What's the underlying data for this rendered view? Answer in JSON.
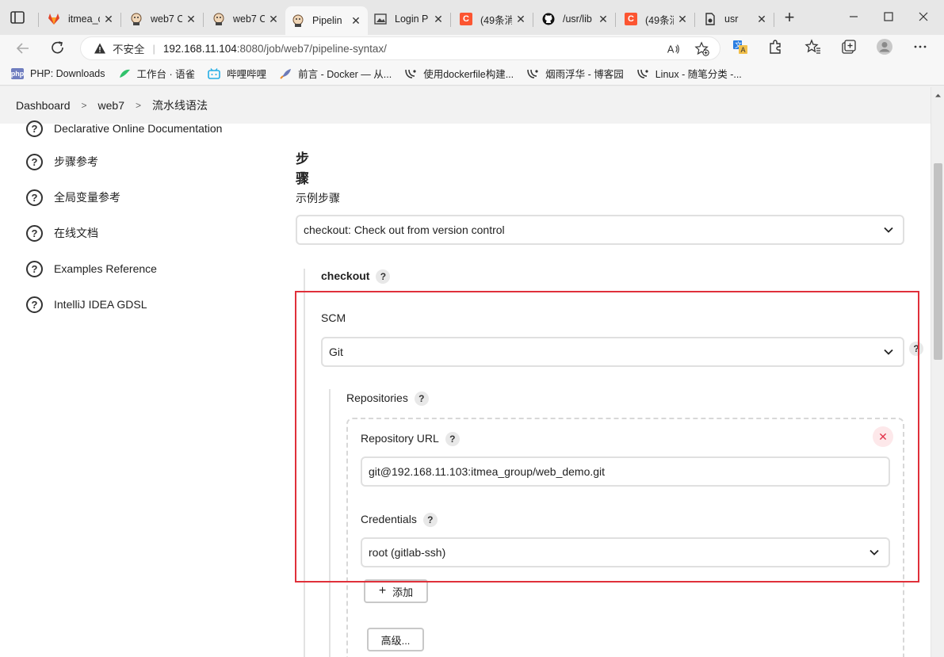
{
  "browser": {
    "tabs": [
      {
        "label": "itmea_c",
        "icon": "gitlab-icon",
        "color": "#e24329"
      },
      {
        "label": "web7 C",
        "icon": "jenkins-icon",
        "color": "#d33833"
      },
      {
        "label": "web7 C",
        "icon": "jenkins-icon",
        "color": "#d33833"
      },
      {
        "label": "Pipelin",
        "icon": "jenkins-icon",
        "color": "#d33833"
      },
      {
        "label": "Login P",
        "icon": "image-icon",
        "color": "#444444"
      },
      {
        "label": "(49条消",
        "icon": "csdn-icon",
        "color": "#fc5531"
      },
      {
        "label": "/usr/lib",
        "icon": "github-icon",
        "color": "#111111"
      },
      {
        "label": "(49条消",
        "icon": "csdn-icon",
        "color": "#fc5531"
      },
      {
        "label": "usr",
        "icon": "file-icon",
        "color": "#333333"
      }
    ],
    "address": {
      "insecure_label": "不安全",
      "url_host": "192.168.11.104",
      "url_rest": ":8080/job/web7/pipeline-syntax/"
    },
    "bookmarks": [
      {
        "label": "PHP: Downloads",
        "icon": "php-icon"
      },
      {
        "label": "工作台 · 语雀",
        "icon": "yuque-icon"
      },
      {
        "label": "哔哩哔哩",
        "icon": "bilibili-icon"
      },
      {
        "label": "前言 - Docker — 从...",
        "icon": "rocket-icon"
      },
      {
        "label": "使用dockerfile构建...",
        "icon": "cnblogs-icon"
      },
      {
        "label": "烟雨浮华 - 博客园",
        "icon": "cnblogs-icon"
      },
      {
        "label": "Linux - 随笔分类 -...",
        "icon": "cnblogs-icon"
      }
    ]
  },
  "breadcrumb": [
    "Dashboard",
    "web7",
    "流水线语法"
  ],
  "sidebar": {
    "items": [
      {
        "label": "Declarative Online Documentation"
      },
      {
        "label": "步骤参考"
      },
      {
        "label": "全局变量参考"
      },
      {
        "label": "在线文档"
      },
      {
        "label": "Examples Reference"
      },
      {
        "label": "IntelliJ IDEA GDSL"
      }
    ]
  },
  "main": {
    "heading": "步骤",
    "sample_step_label": "示例步骤",
    "sample_step_value": "checkout: Check out from version control",
    "checkout_label": "checkout",
    "scm_label": "SCM",
    "scm_value": "Git",
    "repositories_label": "Repositories",
    "repo_url_label": "Repository URL",
    "repo_url_value": "git@192.168.11.103:itmea_group/web_demo.git",
    "credentials_label": "Credentials",
    "credentials_value": "root (gitlab-ssh)",
    "add_button_label": "添加",
    "advanced_button_label": "高级...",
    "help_glyph": "?",
    "delete_glyph": "✕"
  },
  "colors": {
    "highlight_border": "#e0303a",
    "delete_red": "#e2334a"
  }
}
